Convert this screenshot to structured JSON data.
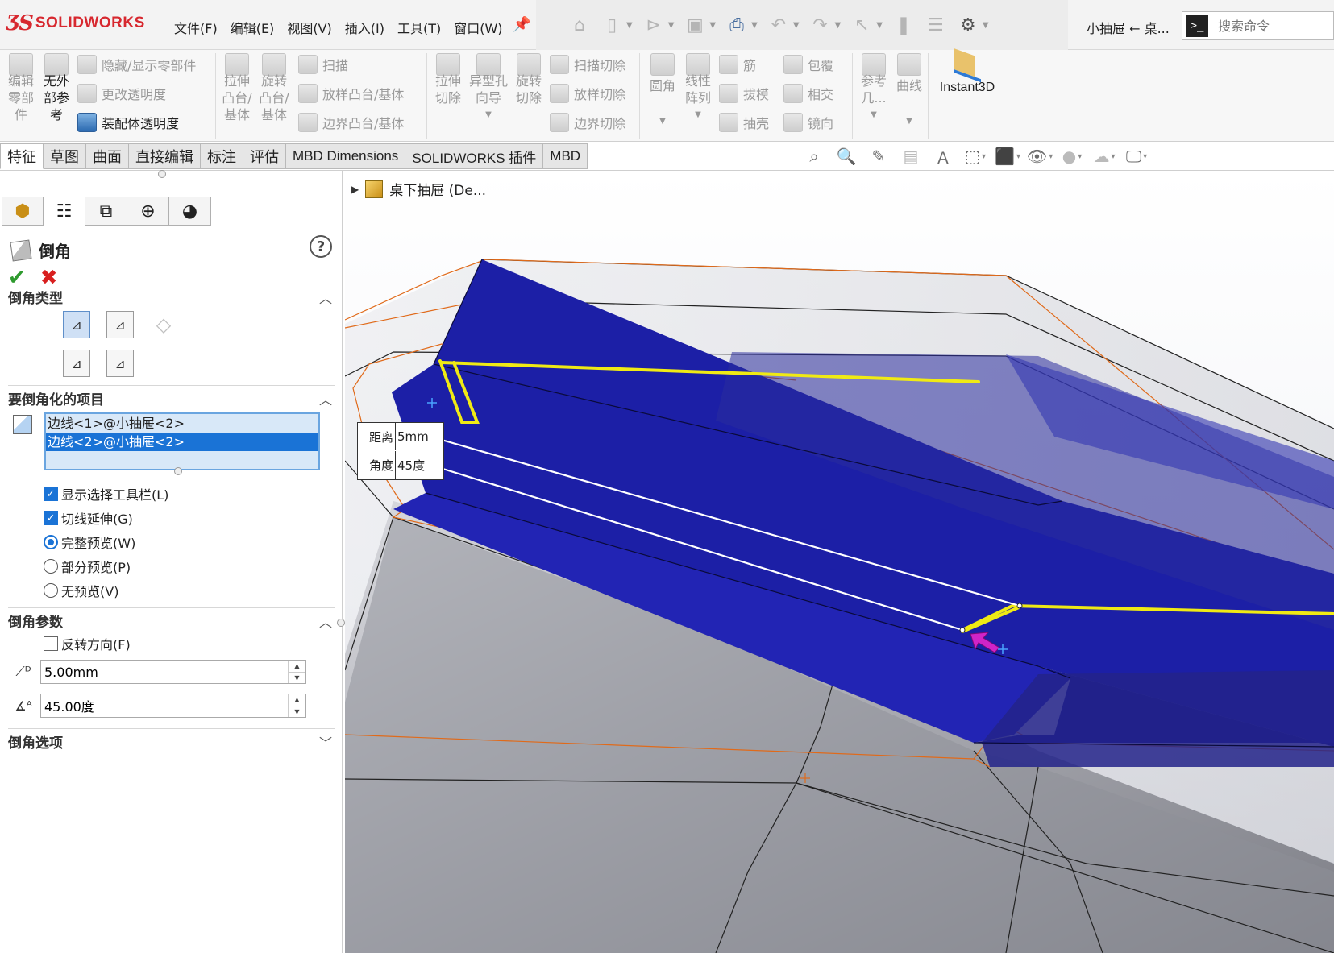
{
  "app": {
    "brand": "SOLIDWORKS",
    "menus": [
      "文件(F)",
      "编辑(E)",
      "视图(V)",
      "插入(I)",
      "工具(T)",
      "窗口(W)"
    ],
    "doc_title": "小抽屉 ← 桌...",
    "search_placeholder": "搜索命令"
  },
  "ribbon": {
    "edit_part": "编辑\n零部\n件",
    "no_external_refs": "无外\n部参\n考",
    "hide_show": "隐藏/显示零部件",
    "change_transparency": "更改透明度",
    "assembly_transparency": "装配体透明度",
    "extrude_boss": "拉伸\n凸台/\n基体",
    "revolve_boss": "旋转\n凸台/\n基体",
    "sweep": "扫描",
    "loft_boss": "放样凸台/基体",
    "boundary_boss": "边界凸台/基体",
    "extrude_cut": "拉伸\n切除",
    "hole_wizard": "异型孔\n向导",
    "revolve_cut": "旋转\n切除",
    "sweep_cut": "扫描切除",
    "loft_cut": "放样切除",
    "boundary_cut": "边界切除",
    "fillet": "圆角",
    "linear_pattern": "线性\n阵列",
    "rib": "筋",
    "draft": "拔模",
    "shell": "抽壳",
    "wrap": "包覆",
    "intersect": "相交",
    "mirror": "镜向",
    "ref_geometry": "参考\n几...",
    "curves": "曲线",
    "instant3d": "Instant3D"
  },
  "tabs": [
    "特征",
    "草图",
    "曲面",
    "直接编辑",
    "标注",
    "评估",
    "MBD Dimensions",
    "SOLIDWORKS 插件",
    "MBD"
  ],
  "feature_tree": {
    "root_label": "桌下抽屉 (De..."
  },
  "property_manager": {
    "title": "倒角",
    "sections": {
      "chamfer_type": "倒角类型",
      "items_to_chamfer": "要倒角化的项目",
      "chamfer_params": "倒角参数",
      "chamfer_options": "倒角选项"
    },
    "selected_items": [
      "边线<1>@小抽屉<2>",
      "边线<2>@小抽屉<2>"
    ],
    "options": {
      "show_selection_toolbar": "显示选择工具栏(L)",
      "tangent_propagation": "切线延伸(G)",
      "full_preview": "完整预览(W)",
      "partial_preview": "部分预览(P)",
      "no_preview": "无预览(V)",
      "reverse_direction": "反转方向(F)"
    },
    "distance_value": "5.00mm",
    "angle_value": "45.00度"
  },
  "callout": {
    "distance_label": "距离",
    "distance_value": "5mm",
    "angle_label": "角度",
    "angle_value": "45度"
  },
  "colors": {
    "model_blue": "#1c1fa6",
    "edge_yellow": "#f0ea14",
    "selection_blue": "#1a73d6",
    "brand_red": "#d7282f"
  }
}
